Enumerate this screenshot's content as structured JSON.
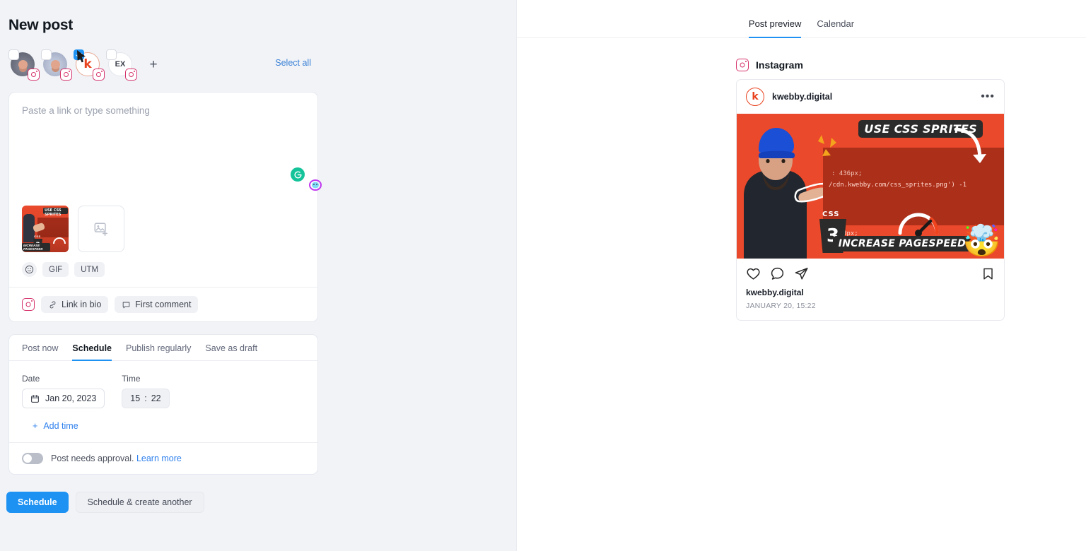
{
  "left": {
    "page_title": "New post",
    "select_all_label": "Select all",
    "add_account_label": "+",
    "accounts": [
      {
        "name": "account-1",
        "initials": "",
        "selected": false,
        "network": "instagram"
      },
      {
        "name": "account-2",
        "initials": "",
        "selected": false,
        "network": "instagram"
      },
      {
        "name": "kwebby.digital",
        "initials": "k",
        "selected": true,
        "network": "instagram"
      },
      {
        "name": "EX",
        "initials": "EX",
        "selected": false,
        "network": "instagram"
      }
    ],
    "composer": {
      "placeholder": "Paste a link or type something",
      "value": "",
      "emoji_label": "☺",
      "gif_label": "GIF",
      "utm_label": "UTM"
    },
    "footer": {
      "link_in_bio": "Link in bio",
      "first_comment": "First comment"
    },
    "schedule": {
      "tabs": [
        {
          "label": "Post now",
          "active": false
        },
        {
          "label": "Schedule",
          "active": true
        },
        {
          "label": "Publish regularly",
          "active": false
        },
        {
          "label": "Save as draft",
          "active": false
        }
      ],
      "date_label": "Date",
      "time_label": "Time",
      "date_value": "Jan 20, 2023",
      "time_hour": "15",
      "time_separator": ":",
      "time_minute": "22",
      "add_time_label": "Add time",
      "add_time_plus": "+",
      "approval_text": "Post needs approval.",
      "approval_link": "Learn more",
      "approval_enabled": false
    },
    "actions": {
      "primary": "Schedule",
      "secondary": "Schedule & create another"
    }
  },
  "right": {
    "tabs": [
      {
        "label": "Post preview",
        "active": true
      },
      {
        "label": "Calendar",
        "active": false
      }
    ],
    "network_label": "Instagram",
    "post": {
      "username": "kwebby.digital",
      "avatar_initial": "k",
      "more_dots": "•••",
      "caption": "kwebby.digital",
      "date": "JANUARY 20, 15:22",
      "image": {
        "headline_top": "USE CSS SPRITES",
        "headline_bottom": "INCREASE PAGESPEED",
        "code_line_1": ": 436px;",
        "code_line_2": "/cdn.kwebby.com/css_sprites.png') -1",
        "code_line_3": "8px;",
        "css_badge": "CSS",
        "css_logo_char": "3",
        "emoji": "🤯"
      }
    }
  },
  "colors": {
    "accent_blue": "#1d92f3",
    "link_blue": "#2f80ed",
    "instagram_pink": "#d6336c",
    "grammarly_green": "#15c39a",
    "panel_bg": "#f1f3f7",
    "image_orange": "#ea492b"
  }
}
